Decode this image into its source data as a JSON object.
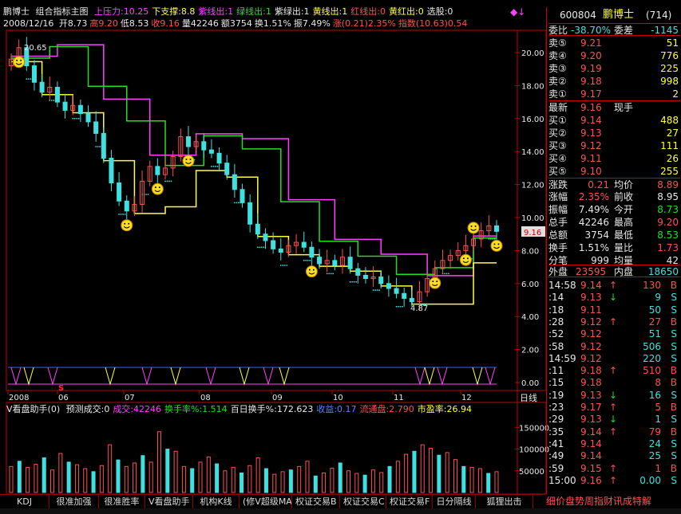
{
  "indicator_header": {
    "stock_name": "鹏博士",
    "indicator": "组合指标主图",
    "items": [
      {
        "label": "上压力:10.25",
        "color": "#ff40ff"
      },
      {
        "label": "下支撑:8.8",
        "color": "#ffff40"
      },
      {
        "label": "紫线出:1",
        "color": "#ff40ff"
      },
      {
        "label": "绿线出:1",
        "color": "#20e020"
      },
      {
        "label": "紫绿出:1",
        "color": "#e8e8e8"
      },
      {
        "label": "黄线出:1",
        "color": "#ffff40"
      },
      {
        "label": "红线出:0",
        "color": "#ff5050"
      },
      {
        "label": "黄红出:0",
        "color": "#ffff40"
      },
      {
        "label": "选股:0",
        "color": "#e8e8e8"
      }
    ]
  },
  "quote_line": {
    "date": "2008/12/16",
    "items": [
      {
        "label": "开8.73",
        "color": "#e8e8e8"
      },
      {
        "label": "高9.20",
        "color": "#ff5050"
      },
      {
        "label": "低8.53",
        "color": "#e8e8e8"
      },
      {
        "label": "收9.16",
        "color": "#ff5050"
      },
      {
        "label": "量42246",
        "color": "#e8e8e8"
      },
      {
        "label": "额3754",
        "color": "#e8e8e8"
      },
      {
        "label": "换1.51%",
        "color": "#e8e8e8"
      },
      {
        "label": "振7.49%",
        "color": "#e8e8e8"
      },
      {
        "label": "涨(0.21)2.35%",
        "color": "#ff5050"
      },
      {
        "label": "指数(10.63)0.54",
        "color": "#ff5050"
      }
    ]
  },
  "chart_data": {
    "type": "candlestick",
    "y_ticks": [
      "20.00",
      "18.00",
      "16.00",
      "14.00",
      "12.00",
      "10.00",
      "8.00",
      "6.00",
      "4.00",
      "2.00",
      "0.00"
    ],
    "ylim": [
      0,
      21
    ],
    "x_ticks": [
      "2008",
      "06",
      "07",
      "08",
      "09",
      "10",
      "11",
      "12"
    ],
    "period_label": "日线",
    "annotations": {
      "high_label": "20.65",
      "low_label": "4.87",
      "current_price_tag": "9.16"
    },
    "sell_marker": "S",
    "series": [
      {
        "name": "close",
        "values": [
          19.6,
          20.3,
          19.2,
          18.2,
          17.6,
          17.9,
          17.0,
          16.5,
          16.8,
          16.3,
          15.8,
          15.1,
          13.6,
          12.1,
          11.0,
          10.4,
          10.8,
          12.2,
          13.1,
          12.6,
          13.0,
          13.7,
          14.9,
          14.3,
          14.6,
          14.1,
          13.9,
          13.3,
          12.6,
          11.7,
          10.9,
          9.6,
          9.0,
          8.6,
          8.1,
          7.9,
          8.3,
          8.5,
          8.2,
          7.6,
          7.2,
          7.4,
          7.1,
          7.6,
          6.9,
          6.5,
          6.3,
          6.4,
          6.0,
          5.7,
          5.4,
          5.1,
          4.9,
          5.5,
          6.3,
          6.9,
          7.4,
          7.7,
          8.0,
          8.3,
          8.7,
          9.2,
          9.5,
          9.16
        ]
      }
    ]
  },
  "volume_panel": {
    "title": "V看盘助手(0)",
    "items": [
      {
        "label": "预测成交:0",
        "color": "#e8e8e8"
      },
      {
        "label": "成交:42246",
        "color": "#ff40ff"
      },
      {
        "label": "换手率%:1.514",
        "color": "#20e020"
      },
      {
        "label": "百日换手%:172.623",
        "color": "#e8e8e8"
      },
      {
        "label": "收益:0.17",
        "color": "#6080ff"
      },
      {
        "label": "流通盘:2.790",
        "color": "#ff5050"
      },
      {
        "label": "市盈率:26.94",
        "color": "#ffff40"
      }
    ],
    "y_ticks": [
      "150000",
      "100000",
      "50000"
    ],
    "ylim": [
      0,
      180000
    ],
    "values": [
      60000,
      72000,
      58000,
      65000,
      80000,
      52000,
      90000,
      70000,
      64000,
      55000,
      48000,
      62000,
      110000,
      75000,
      60000,
      68000,
      85000,
      70000,
      140000,
      100000,
      95000,
      60000,
      55000,
      70000,
      82000,
      66000,
      50000,
      58000,
      45000,
      62000,
      80000,
      55000,
      42000,
      48000,
      52000,
      60000,
      72000,
      38000,
      45000,
      56000,
      68000,
      50000,
      44000,
      40000,
      52000,
      46000,
      60000,
      72000,
      88000,
      95000,
      110000,
      102000,
      86000,
      92000,
      76000,
      60000,
      58000,
      55000,
      44000,
      48000
    ]
  },
  "stock_panel": {
    "code": "600804",
    "name": "鹏博士",
    "number": "(714)",
    "wei_bi_label": "委比",
    "wei_bi": "-38.70%",
    "wei_cha_label": "委差",
    "wei_cha": "-1145",
    "sells": [
      {
        "label": "卖⑤",
        "price": "9.21",
        "vol": "51"
      },
      {
        "label": "卖④",
        "price": "9.20",
        "vol": "776"
      },
      {
        "label": "卖③",
        "price": "9.19",
        "vol": "225"
      },
      {
        "label": "卖②",
        "price": "9.18",
        "vol": "998"
      },
      {
        "label": "卖①",
        "price": "9.17",
        "vol": "2"
      }
    ],
    "latest_label": "最新",
    "latest": "9.16",
    "xian_shou_label": "现手",
    "buys": [
      {
        "label": "买①",
        "price": "9.14",
        "vol": "488"
      },
      {
        "label": "买②",
        "price": "9.13",
        "vol": "27"
      },
      {
        "label": "买③",
        "price": "9.12",
        "vol": "111"
      },
      {
        "label": "买④",
        "price": "9.11",
        "vol": "26"
      },
      {
        "label": "买⑤",
        "price": "9.10",
        "vol": "255"
      }
    ],
    "stats": [
      {
        "l1": "涨跌",
        "v1": "0.21",
        "l2": "均价",
        "v2": "8.89",
        "c1": "#ff5050",
        "c2": "#ff5050"
      },
      {
        "l1": "涨幅",
        "v1": "2.35%",
        "l2": "前收",
        "v2": "8.95",
        "c1": "#ff5050",
        "c2": "#e8e8e8"
      },
      {
        "l1": "振幅",
        "v1": "7.49%",
        "l2": "今开",
        "v2": "8.73",
        "c1": "#e8e8e8",
        "c2": "#20e020"
      },
      {
        "l1": "总手",
        "v1": "42246",
        "l2": "最高",
        "v2": "9.20",
        "c1": "#e8e8e8",
        "c2": "#ff5050"
      },
      {
        "l1": "总额",
        "v1": "3754",
        "l2": "最低",
        "v2": "8.53",
        "c1": "#e8e8e8",
        "c2": "#20e020"
      },
      {
        "l1": "换手",
        "v1": "1.51%",
        "l2": "量比",
        "v2": "1.73",
        "c1": "#e8e8e8",
        "c2": "#ff5050"
      },
      {
        "l1": "分笔",
        "v1": "999",
        "l2": "均量",
        "v2": "42",
        "c1": "#e8e8e8",
        "c2": "#e8e8e8"
      }
    ],
    "outer_label": "外盘",
    "outer": "23595",
    "inner_label": "内盘",
    "inner": "18650"
  },
  "ticks": [
    {
      "time": "14:58",
      "price": "9.14",
      "arrow": "↑",
      "vol": "130",
      "bs": "B",
      "pc": "#ff5050",
      "ac": "#ff5050",
      "vc": "#ff5050"
    },
    {
      "time": ":14",
      "price": "9.13",
      "arrow": "↓",
      "vol": "9",
      "bs": "S",
      "pc": "#ff5050",
      "ac": "#20e020",
      "vc": "#40e0e0"
    },
    {
      "time": ":18",
      "price": "9.11",
      "arrow": "",
      "vol": "50",
      "bs": "S",
      "pc": "#ff5050",
      "ac": "#e8e8e8",
      "vc": "#40e0e0"
    },
    {
      "time": ":28",
      "price": "9.12",
      "arrow": "↑",
      "vol": "27",
      "bs": "B",
      "pc": "#ff5050",
      "ac": "#ff5050",
      "vc": "#ff5050"
    },
    {
      "time": ":52",
      "price": "9.12",
      "arrow": "",
      "vol": "51",
      "bs": "S",
      "pc": "#ff5050",
      "ac": "#e8e8e8",
      "vc": "#40e0e0"
    },
    {
      "time": ":58",
      "price": "9.12",
      "arrow": "",
      "vol": "506",
      "bs": "S",
      "pc": "#ff5050",
      "ac": "#e8e8e8",
      "vc": "#40e0e0"
    },
    {
      "time": "14:59",
      "price": "9.12",
      "arrow": "",
      "vol": "220",
      "bs": "S",
      "pc": "#ff5050",
      "ac": "#e8e8e8",
      "vc": "#40e0e0"
    },
    {
      "time": ":11",
      "price": "9.18",
      "arrow": "↑",
      "vol": "510",
      "bs": "B",
      "pc": "#ff5050",
      "ac": "#ff5050",
      "vc": "#ff5050"
    },
    {
      "time": ":15",
      "price": "9.18",
      "arrow": "",
      "vol": "8",
      "bs": "B",
      "pc": "#ff5050",
      "ac": "#e8e8e8",
      "vc": "#ff5050"
    },
    {
      "time": ":19",
      "price": "9.13",
      "arrow": "↓",
      "vol": "16",
      "bs": "S",
      "pc": "#ff5050",
      "ac": "#20e020",
      "vc": "#40e0e0"
    },
    {
      "time": ":23",
      "price": "9.17",
      "arrow": "↑",
      "vol": "5",
      "bs": "B",
      "pc": "#ff5050",
      "ac": "#ff5050",
      "vc": "#ff5050"
    },
    {
      "time": ":29",
      "price": "9.13",
      "arrow": "↓",
      "vol": "1",
      "bs": "S",
      "pc": "#ff5050",
      "ac": "#20e020",
      "vc": "#40e0e0"
    },
    {
      "time": ":35",
      "price": "9.14",
      "arrow": "↑",
      "vol": "79",
      "bs": "B",
      "pc": "#ff5050",
      "ac": "#ff5050",
      "vc": "#ff5050"
    },
    {
      "time": ":41",
      "price": "9.14",
      "arrow": "",
      "vol": "24",
      "bs": "S",
      "pc": "#ff5050",
      "ac": "#e8e8e8",
      "vc": "#40e0e0"
    },
    {
      "time": ":49",
      "price": "9.14",
      "arrow": "",
      "vol": "25",
      "bs": "S",
      "pc": "#ff5050",
      "ac": "#e8e8e8",
      "vc": "#40e0e0"
    },
    {
      "time": ":59",
      "price": "9.15",
      "arrow": "↑",
      "vol": "1",
      "bs": "B",
      "pc": "#ff5050",
      "ac": "#ff5050",
      "vc": "#ff5050"
    },
    {
      "time": "15:00",
      "price": "9.16",
      "arrow": "↑",
      "vol": "0.00",
      "bs": "S",
      "pc": "#ff5050",
      "ac": "#ff5050",
      "vc": "#40e0e0"
    }
  ],
  "bottom_tabs": [
    "KDJ",
    "很准加强",
    "很准胜率",
    "V看盘助手",
    "机构K线",
    "(修V超级MACD)",
    "权证交易B",
    "权证交易C",
    "权证交易F",
    "日分隔线",
    "狐狸出击"
  ],
  "right_bottom_text": "细价盘势周指财讯成特解",
  "colors": {
    "up": "#ff5050",
    "down": "#40e0e0",
    "axis": "#c00000",
    "magenta": "#ff40ff",
    "yellow": "#ffff40",
    "green": "#20e020"
  }
}
